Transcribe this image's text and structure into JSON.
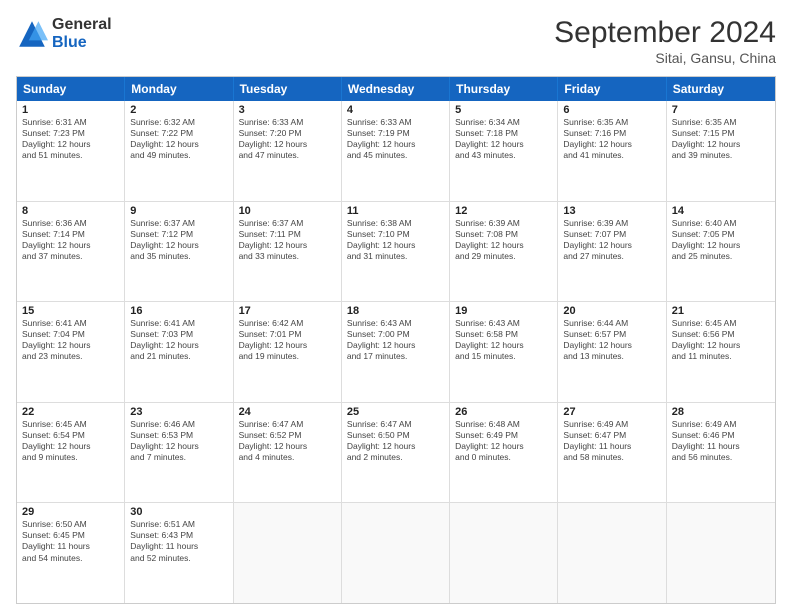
{
  "logo": {
    "general": "General",
    "blue": "Blue"
  },
  "title": "September 2024",
  "subtitle": "Sitai, Gansu, China",
  "header_days": [
    "Sunday",
    "Monday",
    "Tuesday",
    "Wednesday",
    "Thursday",
    "Friday",
    "Saturday"
  ],
  "rows": [
    [
      {
        "day": "1",
        "lines": [
          "Sunrise: 6:31 AM",
          "Sunset: 7:23 PM",
          "Daylight: 12 hours",
          "and 51 minutes."
        ]
      },
      {
        "day": "2",
        "lines": [
          "Sunrise: 6:32 AM",
          "Sunset: 7:22 PM",
          "Daylight: 12 hours",
          "and 49 minutes."
        ]
      },
      {
        "day": "3",
        "lines": [
          "Sunrise: 6:33 AM",
          "Sunset: 7:20 PM",
          "Daylight: 12 hours",
          "and 47 minutes."
        ]
      },
      {
        "day": "4",
        "lines": [
          "Sunrise: 6:33 AM",
          "Sunset: 7:19 PM",
          "Daylight: 12 hours",
          "and 45 minutes."
        ]
      },
      {
        "day": "5",
        "lines": [
          "Sunrise: 6:34 AM",
          "Sunset: 7:18 PM",
          "Daylight: 12 hours",
          "and 43 minutes."
        ]
      },
      {
        "day": "6",
        "lines": [
          "Sunrise: 6:35 AM",
          "Sunset: 7:16 PM",
          "Daylight: 12 hours",
          "and 41 minutes."
        ]
      },
      {
        "day": "7",
        "lines": [
          "Sunrise: 6:35 AM",
          "Sunset: 7:15 PM",
          "Daylight: 12 hours",
          "and 39 minutes."
        ]
      }
    ],
    [
      {
        "day": "8",
        "lines": [
          "Sunrise: 6:36 AM",
          "Sunset: 7:14 PM",
          "Daylight: 12 hours",
          "and 37 minutes."
        ]
      },
      {
        "day": "9",
        "lines": [
          "Sunrise: 6:37 AM",
          "Sunset: 7:12 PM",
          "Daylight: 12 hours",
          "and 35 minutes."
        ]
      },
      {
        "day": "10",
        "lines": [
          "Sunrise: 6:37 AM",
          "Sunset: 7:11 PM",
          "Daylight: 12 hours",
          "and 33 minutes."
        ]
      },
      {
        "day": "11",
        "lines": [
          "Sunrise: 6:38 AM",
          "Sunset: 7:10 PM",
          "Daylight: 12 hours",
          "and 31 minutes."
        ]
      },
      {
        "day": "12",
        "lines": [
          "Sunrise: 6:39 AM",
          "Sunset: 7:08 PM",
          "Daylight: 12 hours",
          "and 29 minutes."
        ]
      },
      {
        "day": "13",
        "lines": [
          "Sunrise: 6:39 AM",
          "Sunset: 7:07 PM",
          "Daylight: 12 hours",
          "and 27 minutes."
        ]
      },
      {
        "day": "14",
        "lines": [
          "Sunrise: 6:40 AM",
          "Sunset: 7:05 PM",
          "Daylight: 12 hours",
          "and 25 minutes."
        ]
      }
    ],
    [
      {
        "day": "15",
        "lines": [
          "Sunrise: 6:41 AM",
          "Sunset: 7:04 PM",
          "Daylight: 12 hours",
          "and 23 minutes."
        ]
      },
      {
        "day": "16",
        "lines": [
          "Sunrise: 6:41 AM",
          "Sunset: 7:03 PM",
          "Daylight: 12 hours",
          "and 21 minutes."
        ]
      },
      {
        "day": "17",
        "lines": [
          "Sunrise: 6:42 AM",
          "Sunset: 7:01 PM",
          "Daylight: 12 hours",
          "and 19 minutes."
        ]
      },
      {
        "day": "18",
        "lines": [
          "Sunrise: 6:43 AM",
          "Sunset: 7:00 PM",
          "Daylight: 12 hours",
          "and 17 minutes."
        ]
      },
      {
        "day": "19",
        "lines": [
          "Sunrise: 6:43 AM",
          "Sunset: 6:58 PM",
          "Daylight: 12 hours",
          "and 15 minutes."
        ]
      },
      {
        "day": "20",
        "lines": [
          "Sunrise: 6:44 AM",
          "Sunset: 6:57 PM",
          "Daylight: 12 hours",
          "and 13 minutes."
        ]
      },
      {
        "day": "21",
        "lines": [
          "Sunrise: 6:45 AM",
          "Sunset: 6:56 PM",
          "Daylight: 12 hours",
          "and 11 minutes."
        ]
      }
    ],
    [
      {
        "day": "22",
        "lines": [
          "Sunrise: 6:45 AM",
          "Sunset: 6:54 PM",
          "Daylight: 12 hours",
          "and 9 minutes."
        ]
      },
      {
        "day": "23",
        "lines": [
          "Sunrise: 6:46 AM",
          "Sunset: 6:53 PM",
          "Daylight: 12 hours",
          "and 7 minutes."
        ]
      },
      {
        "day": "24",
        "lines": [
          "Sunrise: 6:47 AM",
          "Sunset: 6:52 PM",
          "Daylight: 12 hours",
          "and 4 minutes."
        ]
      },
      {
        "day": "25",
        "lines": [
          "Sunrise: 6:47 AM",
          "Sunset: 6:50 PM",
          "Daylight: 12 hours",
          "and 2 minutes."
        ]
      },
      {
        "day": "26",
        "lines": [
          "Sunrise: 6:48 AM",
          "Sunset: 6:49 PM",
          "Daylight: 12 hours",
          "and 0 minutes."
        ]
      },
      {
        "day": "27",
        "lines": [
          "Sunrise: 6:49 AM",
          "Sunset: 6:47 PM",
          "Daylight: 11 hours",
          "and 58 minutes."
        ]
      },
      {
        "day": "28",
        "lines": [
          "Sunrise: 6:49 AM",
          "Sunset: 6:46 PM",
          "Daylight: 11 hours",
          "and 56 minutes."
        ]
      }
    ],
    [
      {
        "day": "29",
        "lines": [
          "Sunrise: 6:50 AM",
          "Sunset: 6:45 PM",
          "Daylight: 11 hours",
          "and 54 minutes."
        ]
      },
      {
        "day": "30",
        "lines": [
          "Sunrise: 6:51 AM",
          "Sunset: 6:43 PM",
          "Daylight: 11 hours",
          "and 52 minutes."
        ]
      },
      {
        "day": "",
        "lines": []
      },
      {
        "day": "",
        "lines": []
      },
      {
        "day": "",
        "lines": []
      },
      {
        "day": "",
        "lines": []
      },
      {
        "day": "",
        "lines": []
      }
    ]
  ]
}
